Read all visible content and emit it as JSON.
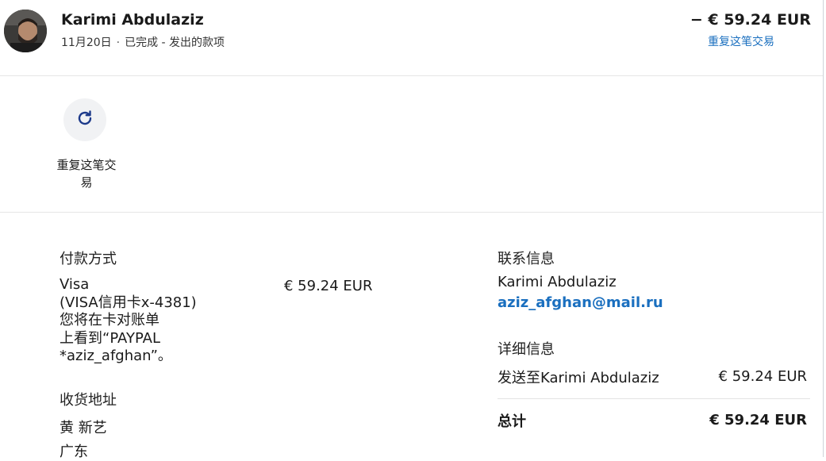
{
  "header": {
    "name": "Karimi Abdulaziz",
    "date": "11月20日",
    "status": "已完成 - 发出的款项",
    "amount": "− € 59.24 EUR",
    "repeat_link": "重复这笔交易"
  },
  "actions": {
    "repeat": {
      "icon": "refresh-icon",
      "label_line1": "重复这笔交",
      "label_line2": "易"
    }
  },
  "payment": {
    "title": "付款方式",
    "method": "Visa",
    "card": "(VISA信用卡x-4381)",
    "statement_line1": "您将在卡对账单",
    "statement_line2": "上看到“PAYPAL",
    "statement_line3": "*aziz_afghan”。",
    "amount": "€ 59.24 EUR"
  },
  "shipping": {
    "title": "收货地址",
    "line1": "黄 新艺",
    "line2": "广东"
  },
  "contact": {
    "title": "联系信息",
    "name": "Karimi Abdulaziz",
    "email": "aziz_afghan@mail.ru"
  },
  "details": {
    "title": "详细信息",
    "sent_to": "发送至Karimi Abdulaziz",
    "sent_amount": "€ 59.24 EUR",
    "total_label": "总计",
    "total_amount": "€ 59.24 EUR"
  },
  "colors": {
    "link": "#1a6fbf",
    "icon": "#1d3a8a",
    "action_bg": "#f1f2f4"
  }
}
